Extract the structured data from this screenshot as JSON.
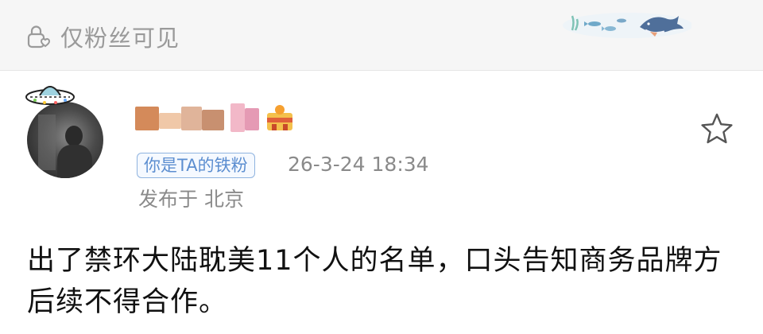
{
  "header": {
    "visibility_label": "仅粉丝可见",
    "visibility_icon": "lock-icon"
  },
  "post": {
    "author_name": "",
    "fan_badge": "你是TA的铁粉",
    "timestamp": "26-3-24 18:34",
    "location": "发布于 北京",
    "content": "出了禁环大陆耽美11个人的名单，口头告知商务品牌方后续不得合作。",
    "favorite_icon": "star-icon"
  },
  "colors": {
    "accent_blue": "#5c8ed0",
    "muted_text": "#8a8a8a",
    "header_bg": "#f6f6f6"
  }
}
